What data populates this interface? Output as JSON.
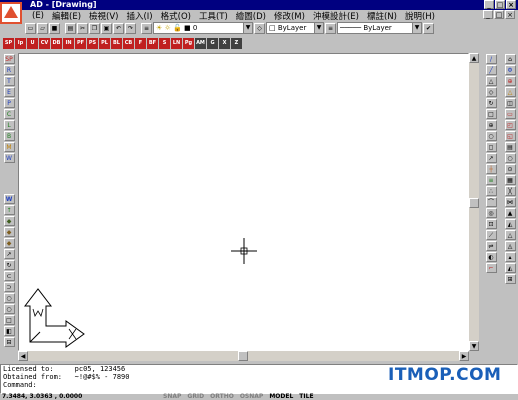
{
  "window": {
    "title": "AD - [Drawing]",
    "controls": [
      "_",
      "□",
      "×"
    ]
  },
  "menu": {
    "items": [
      "(E)",
      "編輯(E)",
      "檢視(V)",
      "插入(I)",
      "格式(O)",
      "工具(T)",
      "繪圖(D)",
      "修改(M)",
      "沖模設計(E)",
      "標註(N)",
      "說明(H)"
    ],
    "doc_controls": [
      "_",
      "□",
      "×"
    ]
  },
  "toolbar1": {
    "layer_value": "0",
    "color_value": "ByLayer",
    "linetype_value": "ByLayer"
  },
  "toolbar2": {
    "buttons": [
      "SP",
      "Ip",
      "U",
      "CV",
      "DB",
      "IN",
      "PF",
      "PS",
      "PL",
      "BL",
      "CB",
      "F",
      "BF",
      "S",
      "LN",
      "Pg",
      "AM",
      "G",
      "X",
      "Z"
    ]
  },
  "left_toolbar": {
    "top": [
      "SP",
      "R",
      "T",
      "E",
      "P",
      "C",
      "L",
      "B",
      "M",
      "W"
    ],
    "bottom": [
      "W",
      "↑",
      "◆",
      "◆",
      "◆",
      "↗",
      "↻",
      "⊂",
      "⊃",
      "○",
      "○",
      "□",
      "◧",
      "⊟"
    ]
  },
  "right_toolbar": [
    "/",
    "╱",
    "△",
    "◇",
    "↻",
    "□",
    "⊕",
    "○",
    "◻",
    "↗",
    "┼",
    "≡",
    "∴",
    "⌒",
    "◎",
    "⊡",
    "⟋",
    "⇌",
    "◐",
    "⌐"
  ],
  "right_toolbar2": [
    "⌂",
    "Φ",
    "⊕",
    "△",
    "◫",
    "▭",
    "◰",
    "◱",
    "▤",
    "○",
    "⊙",
    "▦",
    "╳",
    "⋈",
    "▲",
    "◭",
    "△",
    "◬",
    "▴",
    "◭",
    "⊞"
  ],
  "command": {
    "line1_label": "Licensed to:",
    "line1_value": "pc05, 123456",
    "line2_label": "Obtained from:",
    "line2_value": "~!@#$% - 7890",
    "prompt": "Command:"
  },
  "status": {
    "coords": "7.3484, 3.0363 , 0.0000",
    "modes": [
      "SNAP",
      "GRID",
      "ORTHO",
      "OSNAP",
      "MODEL",
      "TILE"
    ],
    "active_modes": [
      "MODEL",
      "TILE"
    ]
  },
  "watermark": "ITMOP.COM"
}
